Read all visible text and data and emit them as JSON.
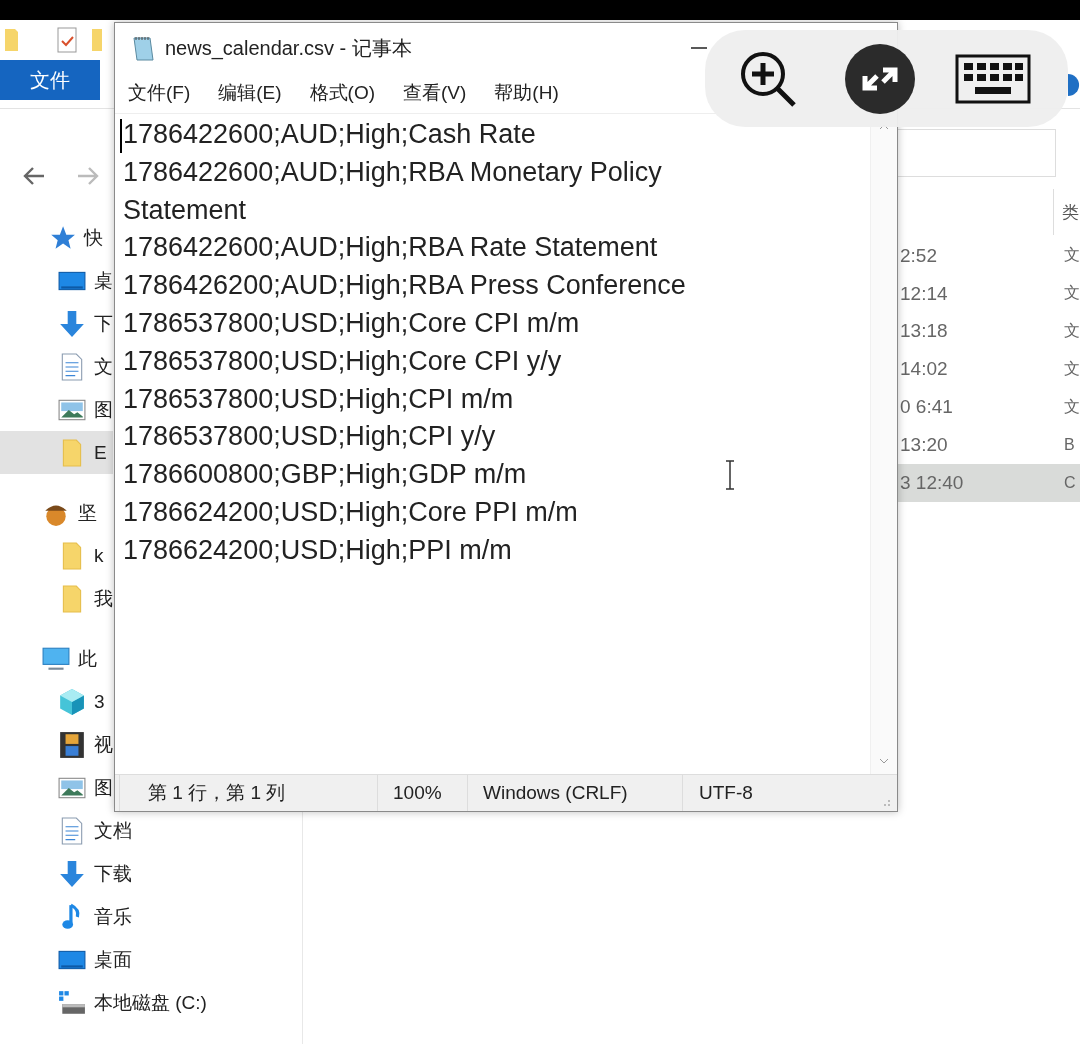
{
  "explorer": {
    "ribbon_tab": "文件",
    "sidebar": [
      {
        "label": "快",
        "kind": "star",
        "selected": false,
        "children": [
          {
            "label": "桌",
            "kind": "desktop",
            "selected": false
          },
          {
            "label": "下",
            "kind": "download",
            "selected": false
          },
          {
            "label": "文",
            "kind": "document",
            "selected": false
          },
          {
            "label": "图",
            "kind": "picture",
            "selected": false
          },
          {
            "label": "E",
            "kind": "folder",
            "selected": true
          }
        ]
      },
      {
        "label": "坚",
        "kind": "nut",
        "selected": false,
        "children": [
          {
            "label": "k",
            "kind": "folder",
            "selected": false
          },
          {
            "label": "我",
            "kind": "folder",
            "selected": false
          }
        ]
      },
      {
        "label": "此",
        "kind": "computer",
        "selected": false,
        "children": [
          {
            "label": "3",
            "kind": "cube",
            "selected": false
          },
          {
            "label": "视",
            "kind": "video",
            "selected": false
          },
          {
            "label": "图",
            "kind": "picture",
            "selected": false
          },
          {
            "label": "文档",
            "kind": "document",
            "selected": false
          },
          {
            "label": "下载",
            "kind": "download",
            "selected": false
          },
          {
            "label": "音乐",
            "kind": "music",
            "selected": false
          },
          {
            "label": "桌面",
            "kind": "desktop",
            "selected": false
          },
          {
            "label": "本地磁盘 (C:)",
            "kind": "drive",
            "selected": false
          }
        ]
      }
    ],
    "column_header": "类",
    "rows": [
      {
        "modified": "2:52",
        "type": "文",
        "selected": false
      },
      {
        "modified": "12:14",
        "type": "文",
        "selected": false
      },
      {
        "modified": "13:18",
        "type": "文",
        "selected": false
      },
      {
        "modified": "14:02",
        "type": "文",
        "selected": false
      },
      {
        "modified": "0 6:41",
        "type": "文",
        "selected": false
      },
      {
        "modified": "13:20",
        "type": "B",
        "selected": false
      },
      {
        "modified": "3 12:40",
        "type": "C",
        "selected": true
      }
    ]
  },
  "notepad": {
    "title": "news_calendar.csv - 记事本",
    "menu": [
      "文件(F)",
      "编辑(E)",
      "格式(O)",
      "查看(V)",
      "帮助(H)"
    ],
    "lines": [
      "1786422600;AUD;High;Cash Rate",
      "1786422600;AUD;High;RBA Monetary Policy",
      "Statement",
      "1786422600;AUD;High;RBA Rate Statement",
      "1786426200;AUD;High;RBA Press Conference",
      "1786537800;USD;High;Core CPI m/m",
      "1786537800;USD;High;Core CPI y/y",
      "1786537800;USD;High;CPI m/m",
      "1786537800;USD;High;CPI y/y",
      "1786600800;GBP;High;GDP m/m",
      "1786624200;USD;High;Core PPI m/m",
      "1786624200;USD;High;PPI m/m"
    ],
    "status": {
      "position": "第 1 行，第 1 列",
      "zoom": "100%",
      "line_ending": "Windows (CRLF)",
      "encoding": "UTF-8"
    }
  }
}
